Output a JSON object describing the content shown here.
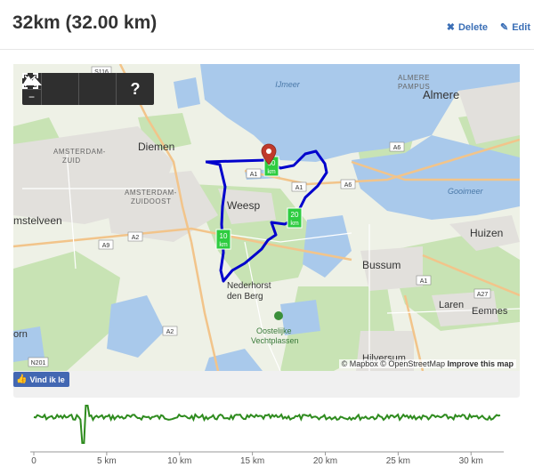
{
  "header": {
    "title": "32km (32.00 km)",
    "delete_label": "Delete",
    "edit_label": "Edit",
    "delete_icon": "close-icon",
    "edit_icon": "pencil-icon"
  },
  "map": {
    "toolbar": {
      "zoom_in": "+",
      "zoom_out": "−",
      "fullscreen_icon": "fullscreen-icon",
      "terrain_icon": "mountain-icon",
      "help_label": "?"
    },
    "labels": {
      "ijmeer": "IJmeer",
      "almere_pampus": "ALMERE\nPAMPUS",
      "almere": "Almere",
      "diemen": "Diemen",
      "amsterdam_zuid": "AMSTERDAM-\nZUID",
      "amsterdam_zuidoost": "AMSTERDAM-\nZUIDOOST",
      "weesp": "Weesp",
      "gooimeer": "Gooimeer",
      "amstelveen": "mstelveen",
      "huizen": "Huizen",
      "bussum": "Bussum",
      "nederhorst": "Nederhorst\nden Berg",
      "laren": "Laren",
      "eemnes": "Eemnes",
      "oostelijke": "Oostelijke\nVechtplassen",
      "horn": "orn",
      "hilversum": "Hilversum"
    },
    "road_shields": [
      "S116",
      "A1",
      "A1",
      "A6",
      "A6",
      "A9",
      "A2",
      "A2",
      "A1",
      "A27",
      "N201"
    ],
    "km_markers": [
      {
        "km": 10,
        "label": "10\nkm"
      },
      {
        "km": 20,
        "label": "20\nkm"
      },
      {
        "km": 30,
        "label": "30\nkm"
      }
    ],
    "attribution": {
      "mapbox": "© Mapbox",
      "osm": "© OpenStreetMap",
      "improve": "Improve this map"
    }
  },
  "facebook": {
    "label": "Vind ik le",
    "icon": "thumbs-up-icon",
    "color": "#4267b2"
  },
  "profile": {
    "x_ticks": [
      "0",
      "5 km",
      "10 km",
      "15 km",
      "20 km",
      "25 km",
      "30 km"
    ],
    "x_tick_values": [
      0,
      5,
      10,
      15,
      20,
      25,
      30
    ],
    "x_max_km": 32,
    "line_color": "#2e8b1e",
    "route_color": "#0000cc"
  }
}
